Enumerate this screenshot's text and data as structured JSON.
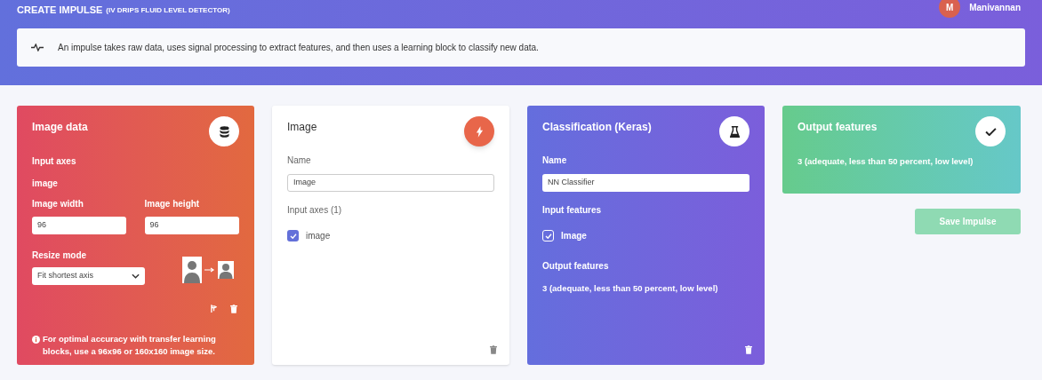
{
  "header": {
    "title": "CREATE IMPULSE",
    "subtitle": "(IV DRIPS FLUID LEVEL DETECTOR)",
    "user": {
      "initial": "M",
      "name": "Manivannan"
    }
  },
  "info": {
    "text": "An impulse takes raw data, uses signal processing to extract features, and then uses a learning block to classify new data."
  },
  "blocks": [
    {
      "kind": "input",
      "title": "Image data",
      "input_axes_label": "Input axes",
      "input_axes_value": "image",
      "width_label": "Image width",
      "width_value": "96",
      "height_label": "Image height",
      "height_value": "96",
      "resize_label": "Resize mode",
      "resize_value": "Fit shortest axis",
      "note": "For optimal accuracy with transfer learning blocks, use a 96x96 or 160x160 image size."
    },
    {
      "kind": "processing",
      "title": "Image",
      "name_label": "Name",
      "name_value": "Image",
      "axes_label": "Input axes (1)",
      "axes": [
        {
          "label": "image",
          "checked": true
        }
      ]
    },
    {
      "kind": "learning",
      "title": "Classification (Keras)",
      "name_label": "Name",
      "name_value": "NN Classifier",
      "features_label": "Input features",
      "features": [
        {
          "label": "Image",
          "checked": true
        }
      ],
      "output_label": "Output features",
      "output_value": "3 (adequate, less than 50 percent, low level)"
    },
    {
      "kind": "output",
      "title": "Output features",
      "value": "3 (adequate, less than 50 percent, low level)",
      "save_button": {
        "label": "Save Impulse",
        "disabled": true
      }
    }
  ]
}
